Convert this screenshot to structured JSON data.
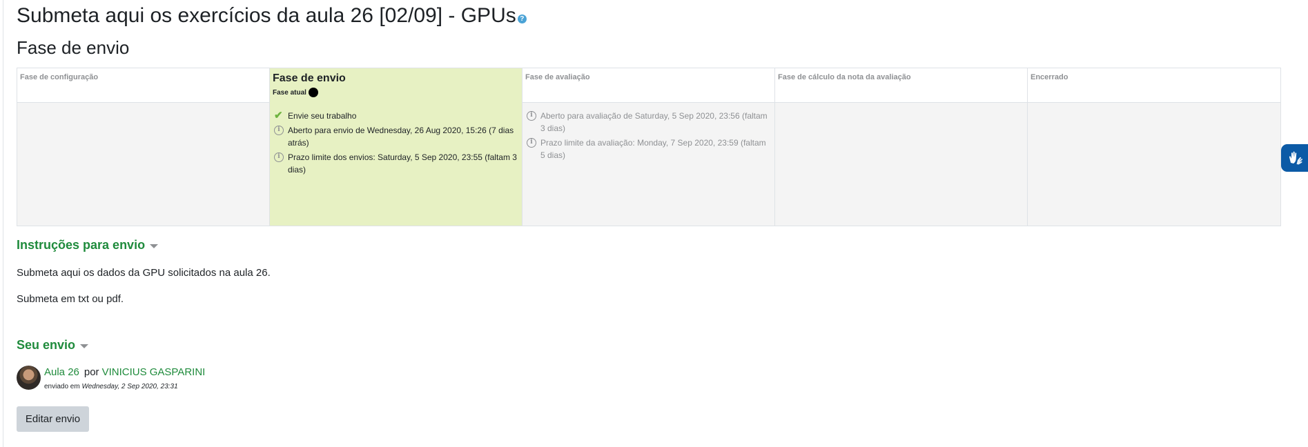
{
  "page": {
    "title": "Submeta aqui os exercícios da aula 26 [02/09] - GPUs",
    "help_icon": "?",
    "phase_heading": "Fase de envio"
  },
  "planner": {
    "phases": [
      {
        "name": "Fase de configuração",
        "active": false,
        "tasks": []
      },
      {
        "name": "Fase de envio",
        "active": true,
        "current_label": "Fase atual",
        "tasks": [
          {
            "icon": "check-icon",
            "text": "Envie seu trabalho"
          },
          {
            "icon": "info-icon",
            "text": "Aberto para envio de Wednesday, 26 Aug 2020, 15:26 (7 dias atrás)"
          },
          {
            "icon": "info-icon",
            "text": "Prazo limite dos envios: Saturday, 5 Sep 2020, 23:55 (faltam 3 dias)"
          }
        ]
      },
      {
        "name": "Fase de avaliação",
        "active": false,
        "tasks": [
          {
            "icon": "info-icon",
            "text": "Aberto para avaliação de Saturday, 5 Sep 2020, 23:56 (faltam 3 dias)"
          },
          {
            "icon": "info-icon",
            "text": "Prazo limite da avaliação: Monday, 7 Sep 2020, 23:59 (faltam 5 dias)"
          }
        ]
      },
      {
        "name": "Fase de cálculo da nota da avaliação",
        "active": false,
        "tasks": []
      },
      {
        "name": "Encerrado",
        "active": false,
        "tasks": []
      }
    ]
  },
  "instructions": {
    "heading": "Instruções para envio",
    "paragraphs": [
      "Submeta aqui os dados da GPU solicitados na aula 26.",
      "Submeta em txt ou pdf."
    ]
  },
  "submission": {
    "heading": "Seu envio",
    "title_link": "Aula 26",
    "by_label": "por",
    "author_link": "VINICIUS GASPARINI",
    "sent_label": "enviado em",
    "sent_date": "Wednesday, 2 Sep 2020, 23:31",
    "edit_button": "Editar envio"
  },
  "colors": {
    "active_phase_bg": "#e7f1c3",
    "link_green": "#1f8b3c",
    "accessibility_blue": "#0b5aa6"
  }
}
